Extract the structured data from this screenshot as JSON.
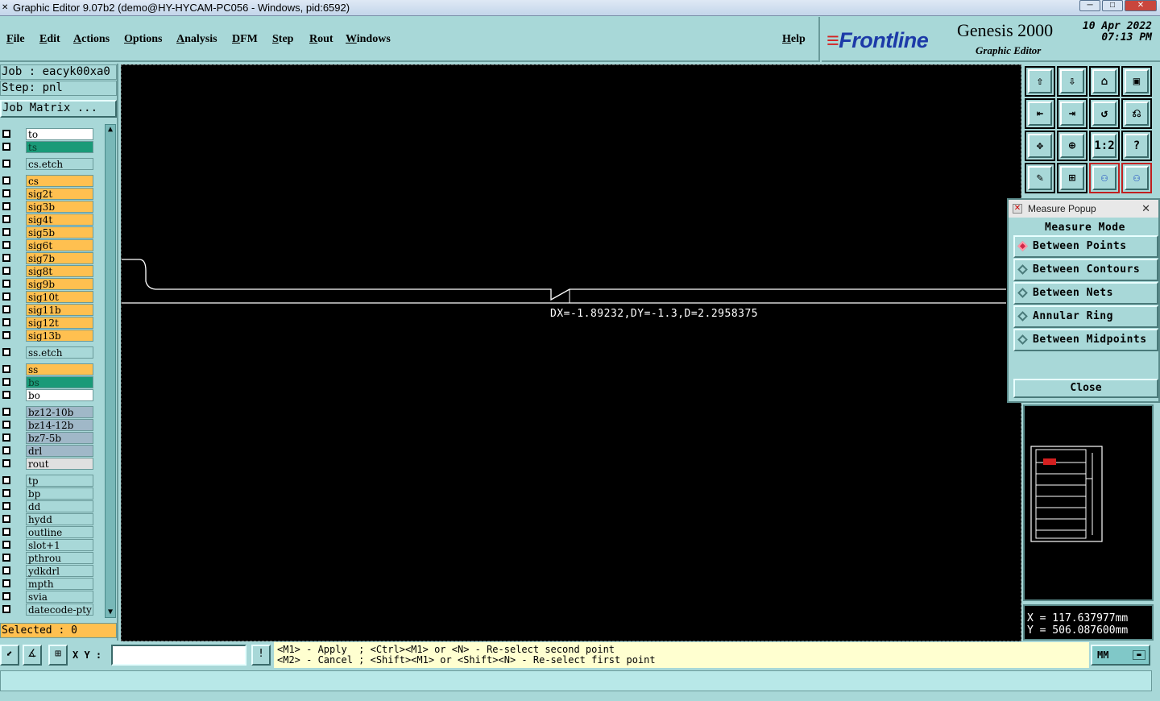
{
  "window": {
    "title": "Graphic Editor 9.07b2 (demo@HY-HYCAM-PC056 - Windows, pid:6592)",
    "controls": [
      "minimize",
      "maximize",
      "close"
    ]
  },
  "menu": {
    "items": [
      "File",
      "Edit",
      "Actions",
      "Options",
      "Analysis",
      "DFM",
      "Step",
      "Rout",
      "Windows"
    ],
    "help": "Help"
  },
  "brand": {
    "logo_text": "Frontline",
    "product": "Genesis 2000",
    "subtitle": "Graphic Editor",
    "date": "10 Apr 2022",
    "time": "07:13 PM"
  },
  "left_panel": {
    "job": "Job : eacyk00xa0",
    "step": "Step: pnl",
    "job_matrix": "Job Matrix ...",
    "selected": "Selected : 0",
    "layers": [
      {
        "name": "to",
        "color": "#ffffff"
      },
      {
        "name": "ts",
        "color": "#1a9a78"
      },
      {
        "name": "cs.etch",
        "color": "#a8d8d8"
      },
      {
        "name": "cs",
        "color": "#ffc050"
      },
      {
        "name": "sig2t",
        "color": "#ffc050"
      },
      {
        "name": "sig3b",
        "color": "#ffc050"
      },
      {
        "name": "sig4t",
        "color": "#ffc050"
      },
      {
        "name": "sig5b",
        "color": "#ffc050"
      },
      {
        "name": "sig6t",
        "color": "#ffc050"
      },
      {
        "name": "sig7b",
        "color": "#ffc050"
      },
      {
        "name": "sig8t",
        "color": "#ffc050"
      },
      {
        "name": "sig9b",
        "color": "#ffc050"
      },
      {
        "name": "sig10t",
        "color": "#ffc050"
      },
      {
        "name": "sig11b",
        "color": "#ffc050"
      },
      {
        "name": "sig12t",
        "color": "#ffc050"
      },
      {
        "name": "sig13b",
        "color": "#ffc050"
      },
      {
        "name": "ss.etch",
        "color": "#a8d8d8"
      },
      {
        "name": "ss",
        "color": "#ffc050"
      },
      {
        "name": "bs",
        "color": "#1a9a78"
      },
      {
        "name": "bo",
        "color": "#ffffff"
      },
      {
        "name": "bz12-10b",
        "color": "#a0b8c8"
      },
      {
        "name": "bz14-12b",
        "color": "#a0b8c8"
      },
      {
        "name": "bz7-5b",
        "color": "#a0b8c8"
      },
      {
        "name": "drl",
        "color": "#a0b8c8"
      },
      {
        "name": "rout",
        "color": "#e0e0e0"
      },
      {
        "name": "tp",
        "color": "#a8d8d8"
      },
      {
        "name": "bp",
        "color": "#a8d8d8"
      },
      {
        "name": "dd",
        "color": "#a8d8d8"
      },
      {
        "name": "hydd",
        "color": "#a8d8d8"
      },
      {
        "name": "outline",
        "color": "#a8d8d8"
      },
      {
        "name": "slot+1",
        "color": "#a8d8d8"
      },
      {
        "name": "pthrou",
        "color": "#a8d8d8"
      },
      {
        "name": "ydkdrl",
        "color": "#a8d8d8"
      },
      {
        "name": "mpth",
        "color": "#a8d8d8"
      },
      {
        "name": "svia",
        "color": "#a8d8d8"
      },
      {
        "name": "datecode-pty",
        "color": "#a8d8d8"
      }
    ]
  },
  "canvas": {
    "measurement": "DX=-1.89232,DY=-1.3,D=2.2958375"
  },
  "tools": [
    "zoom-home-icon",
    "zoom-down-icon",
    "home-icon",
    "window-icon",
    "pan-left-icon",
    "pan-right-icon",
    "undo-view-icon",
    "redraw-icon",
    "fit-all-icon",
    "zoom-center-icon",
    "scale-1-2-icon",
    "help-icon",
    "measure-tool-icon",
    "grid-icon",
    "net-highlight-icon",
    "net-compare-icon"
  ],
  "tool_labels": [
    "1:2",
    "?"
  ],
  "measure_popup": {
    "title": "Measure Popup",
    "header": "Measure Mode",
    "modes": [
      "Between Points",
      "Between Contours",
      "Between Nets",
      "Annular Ring",
      "Between Midpoints"
    ],
    "selected_mode": "Between Points",
    "close": "Close"
  },
  "coords": {
    "x": "X = 117.637977mm",
    "y": "Y = 506.087600mm"
  },
  "bottom": {
    "xy_label": "X Y :",
    "xy_value": "",
    "info_button": "!",
    "hint_line1": "<M1> - Apply  ; <Ctrl><M1> or <N> - Re-select second point",
    "hint_line2": "<M2> - Cancel ; <Shift><M1> or <Shift><N> - Re-select first point",
    "units": "MM"
  }
}
